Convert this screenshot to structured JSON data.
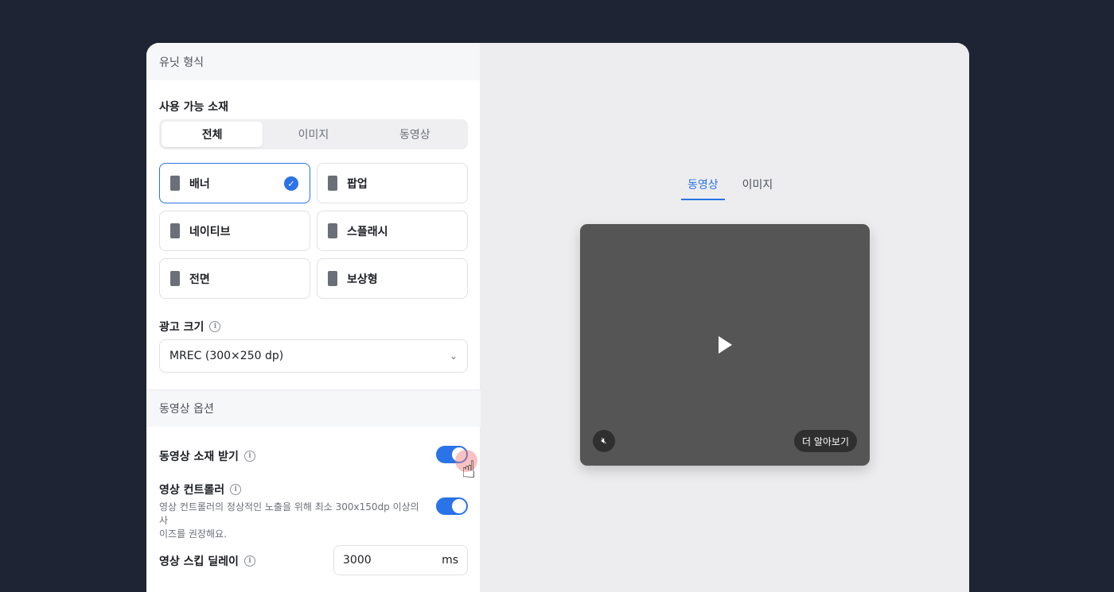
{
  "unit_section": {
    "title": "유닛 형식"
  },
  "materials": {
    "label": "사용 가능 소재",
    "tabs": [
      "전체",
      "이미지",
      "동영상"
    ],
    "active_tab": "전체"
  },
  "formats": [
    {
      "label": "배너",
      "selected": true
    },
    {
      "label": "팝업",
      "selected": false
    },
    {
      "label": "네이티브",
      "selected": false
    },
    {
      "label": "스플래시",
      "selected": false
    },
    {
      "label": "전면",
      "selected": false
    },
    {
      "label": "보상형",
      "selected": false
    }
  ],
  "ad_size": {
    "label": "광고 크기",
    "value": "MREC (300×250 dp)"
  },
  "video_section": {
    "title": "동영상 옵션"
  },
  "video_options": {
    "receive_label": "동영상 소재 받기",
    "receive_on": true,
    "controller_label": "영상 컨트롤러",
    "controller_on": true,
    "controller_desc_1": "영상 컨트롤러의 정상적인 노출을 위해 최소 300x150dp 이상의 사",
    "controller_desc_2": "이즈를 권장해요.",
    "skip_delay_label": "영상 스킵 딜레이",
    "skip_delay_value": "3000",
    "skip_delay_unit": "ms"
  },
  "preview": {
    "tabs": [
      "동영상",
      "이미지"
    ],
    "active_tab": "동영상",
    "learn_more": "더 알아보기"
  },
  "colors": {
    "accent": "#2a73e8",
    "background": "#1e2433",
    "video_bg": "#555555"
  }
}
